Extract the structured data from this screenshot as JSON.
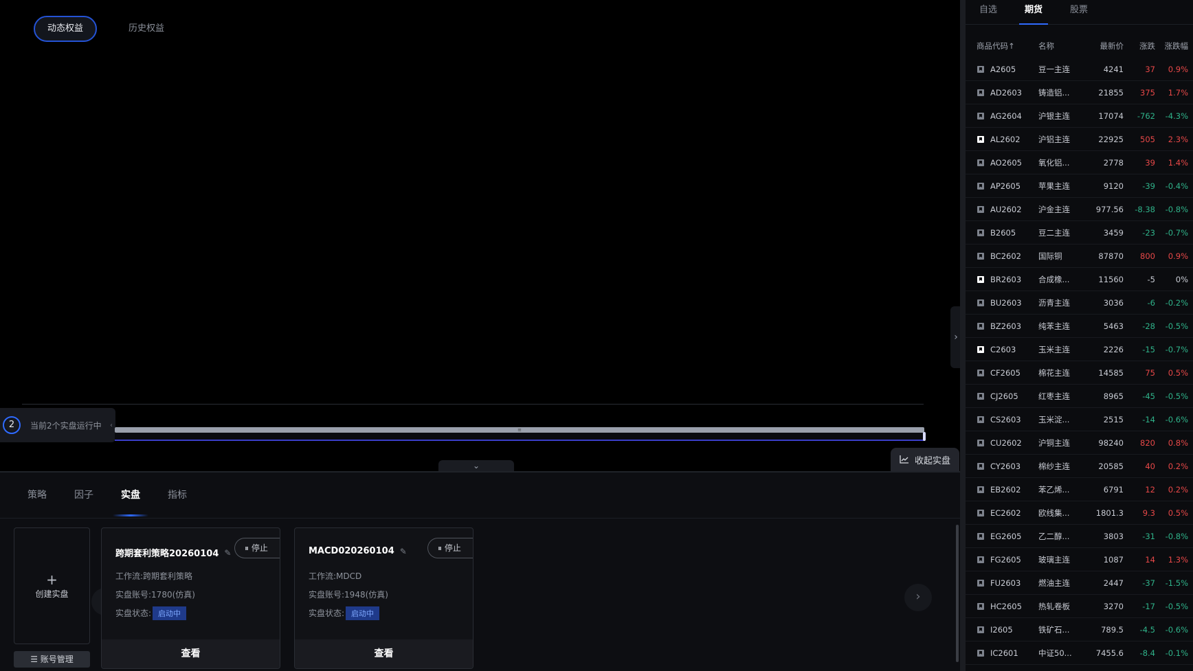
{
  "equity_tabs": [
    "动态权益",
    "历史权益"
  ],
  "running": {
    "count": "2",
    "text": "当前2个实盘运行中",
    "collapse_glyph": "‹"
  },
  "fold_live": {
    "label": "收起实盘"
  },
  "expand_glyph": "›",
  "collapse_glyph": "⌄",
  "panel_tabs": [
    "策略",
    "因子",
    "实盘",
    "指标"
  ],
  "create_card": {
    "label": "创建实盘"
  },
  "account_button": "☰ 账号管理",
  "live_cards": [
    {
      "title": "跨期套利策略20260104",
      "stop_label": "停止",
      "workflow_label": "工作流:",
      "workflow": "跨期套利策略",
      "account_label": "实盘账号:",
      "account": "1780(仿真)",
      "status_label": "实盘状态:",
      "status": "启动中",
      "view_label": "查看"
    },
    {
      "title": "MACD020260104",
      "stop_label": "停止",
      "workflow_label": "工作流:",
      "workflow": "MDCD",
      "account_label": "实盘账号:",
      "account": "1948(仿真)",
      "status_label": "实盘状态:",
      "status": "启动中",
      "view_label": "查看"
    }
  ],
  "market_tabs": [
    "自选",
    "期货",
    "股票"
  ],
  "quote_headers": [
    "商品代码↑",
    "名称",
    "最新价",
    "涨跌",
    "涨跌幅"
  ],
  "quotes": [
    {
      "code": "A2605",
      "name": "豆一主连",
      "price": "4241",
      "chg": "37",
      "pct": "0.9%",
      "dir": "up",
      "fav": false
    },
    {
      "code": "AD2603",
      "name": "铸造铝...",
      "price": "21855",
      "chg": "375",
      "pct": "1.7%",
      "dir": "up",
      "fav": false
    },
    {
      "code": "AG2604",
      "name": "沪银主连",
      "price": "17074",
      "chg": "-762",
      "pct": "-4.3%",
      "dir": "down",
      "fav": false
    },
    {
      "code": "AL2602",
      "name": "沪铝主连",
      "price": "22925",
      "chg": "505",
      "pct": "2.3%",
      "dir": "up",
      "fav": true
    },
    {
      "code": "AO2605",
      "name": "氧化铝...",
      "price": "2778",
      "chg": "39",
      "pct": "1.4%",
      "dir": "up",
      "fav": false
    },
    {
      "code": "AP2605",
      "name": "苹果主连",
      "price": "9120",
      "chg": "-39",
      "pct": "-0.4%",
      "dir": "down",
      "fav": false
    },
    {
      "code": "AU2602",
      "name": "沪金主连",
      "price": "977.56",
      "chg": "-8.38",
      "pct": "-0.8%",
      "dir": "down",
      "fav": false
    },
    {
      "code": "B2605",
      "name": "豆二主连",
      "price": "3459",
      "chg": "-23",
      "pct": "-0.7%",
      "dir": "down",
      "fav": false
    },
    {
      "code": "BC2602",
      "name": "国际铜",
      "price": "87870",
      "chg": "800",
      "pct": "0.9%",
      "dir": "up",
      "fav": false
    },
    {
      "code": "BR2603",
      "name": "合成橡...",
      "price": "11560",
      "chg": "-5",
      "pct": "0%",
      "dir": "flat",
      "fav": true
    },
    {
      "code": "BU2603",
      "name": "沥青主连",
      "price": "3036",
      "chg": "-6",
      "pct": "-0.2%",
      "dir": "down",
      "fav": false
    },
    {
      "code": "BZ2603",
      "name": "纯苯主连",
      "price": "5463",
      "chg": "-28",
      "pct": "-0.5%",
      "dir": "down",
      "fav": false
    },
    {
      "code": "C2603",
      "name": "玉米主连",
      "price": "2226",
      "chg": "-15",
      "pct": "-0.7%",
      "dir": "down",
      "fav": true
    },
    {
      "code": "CF2605",
      "name": "棉花主连",
      "price": "14585",
      "chg": "75",
      "pct": "0.5%",
      "dir": "up",
      "fav": false
    },
    {
      "code": "CJ2605",
      "name": "红枣主连",
      "price": "8965",
      "chg": "-45",
      "pct": "-0.5%",
      "dir": "down",
      "fav": false
    },
    {
      "code": "CS2603",
      "name": "玉米淀...",
      "price": "2515",
      "chg": "-14",
      "pct": "-0.6%",
      "dir": "down",
      "fav": false
    },
    {
      "code": "CU2602",
      "name": "沪铜主连",
      "price": "98240",
      "chg": "820",
      "pct": "0.8%",
      "dir": "up",
      "fav": false
    },
    {
      "code": "CY2603",
      "name": "棉纱主连",
      "price": "20585",
      "chg": "40",
      "pct": "0.2%",
      "dir": "up",
      "fav": false
    },
    {
      "code": "EB2602",
      "name": "苯乙烯...",
      "price": "6791",
      "chg": "12",
      "pct": "0.2%",
      "dir": "up",
      "fav": false
    },
    {
      "code": "EC2602",
      "name": "欧线集...",
      "price": "1801.3",
      "chg": "9.3",
      "pct": "0.5%",
      "dir": "up",
      "fav": false
    },
    {
      "code": "EG2605",
      "name": "乙二醇...",
      "price": "3803",
      "chg": "-31",
      "pct": "-0.8%",
      "dir": "down",
      "fav": false
    },
    {
      "code": "FG2605",
      "name": "玻璃主连",
      "price": "1087",
      "chg": "14",
      "pct": "1.3%",
      "dir": "up",
      "fav": false
    },
    {
      "code": "FU2603",
      "name": "燃油主连",
      "price": "2447",
      "chg": "-37",
      "pct": "-1.5%",
      "dir": "down",
      "fav": false
    },
    {
      "code": "HC2605",
      "name": "热轧卷板",
      "price": "3270",
      "chg": "-17",
      "pct": "-0.5%",
      "dir": "down",
      "fav": false
    },
    {
      "code": "I2605",
      "name": "铁矿石...",
      "price": "789.5",
      "chg": "-4.5",
      "pct": "-0.6%",
      "dir": "down",
      "fav": false
    },
    {
      "code": "IC2601",
      "name": "中证50...",
      "price": "7455.6",
      "chg": "-8.4",
      "pct": "-0.1%",
      "dir": "down",
      "fav": false
    }
  ],
  "colors": {
    "up": "#e84848",
    "down": "#2fb38a",
    "accent": "#2f6bff"
  }
}
